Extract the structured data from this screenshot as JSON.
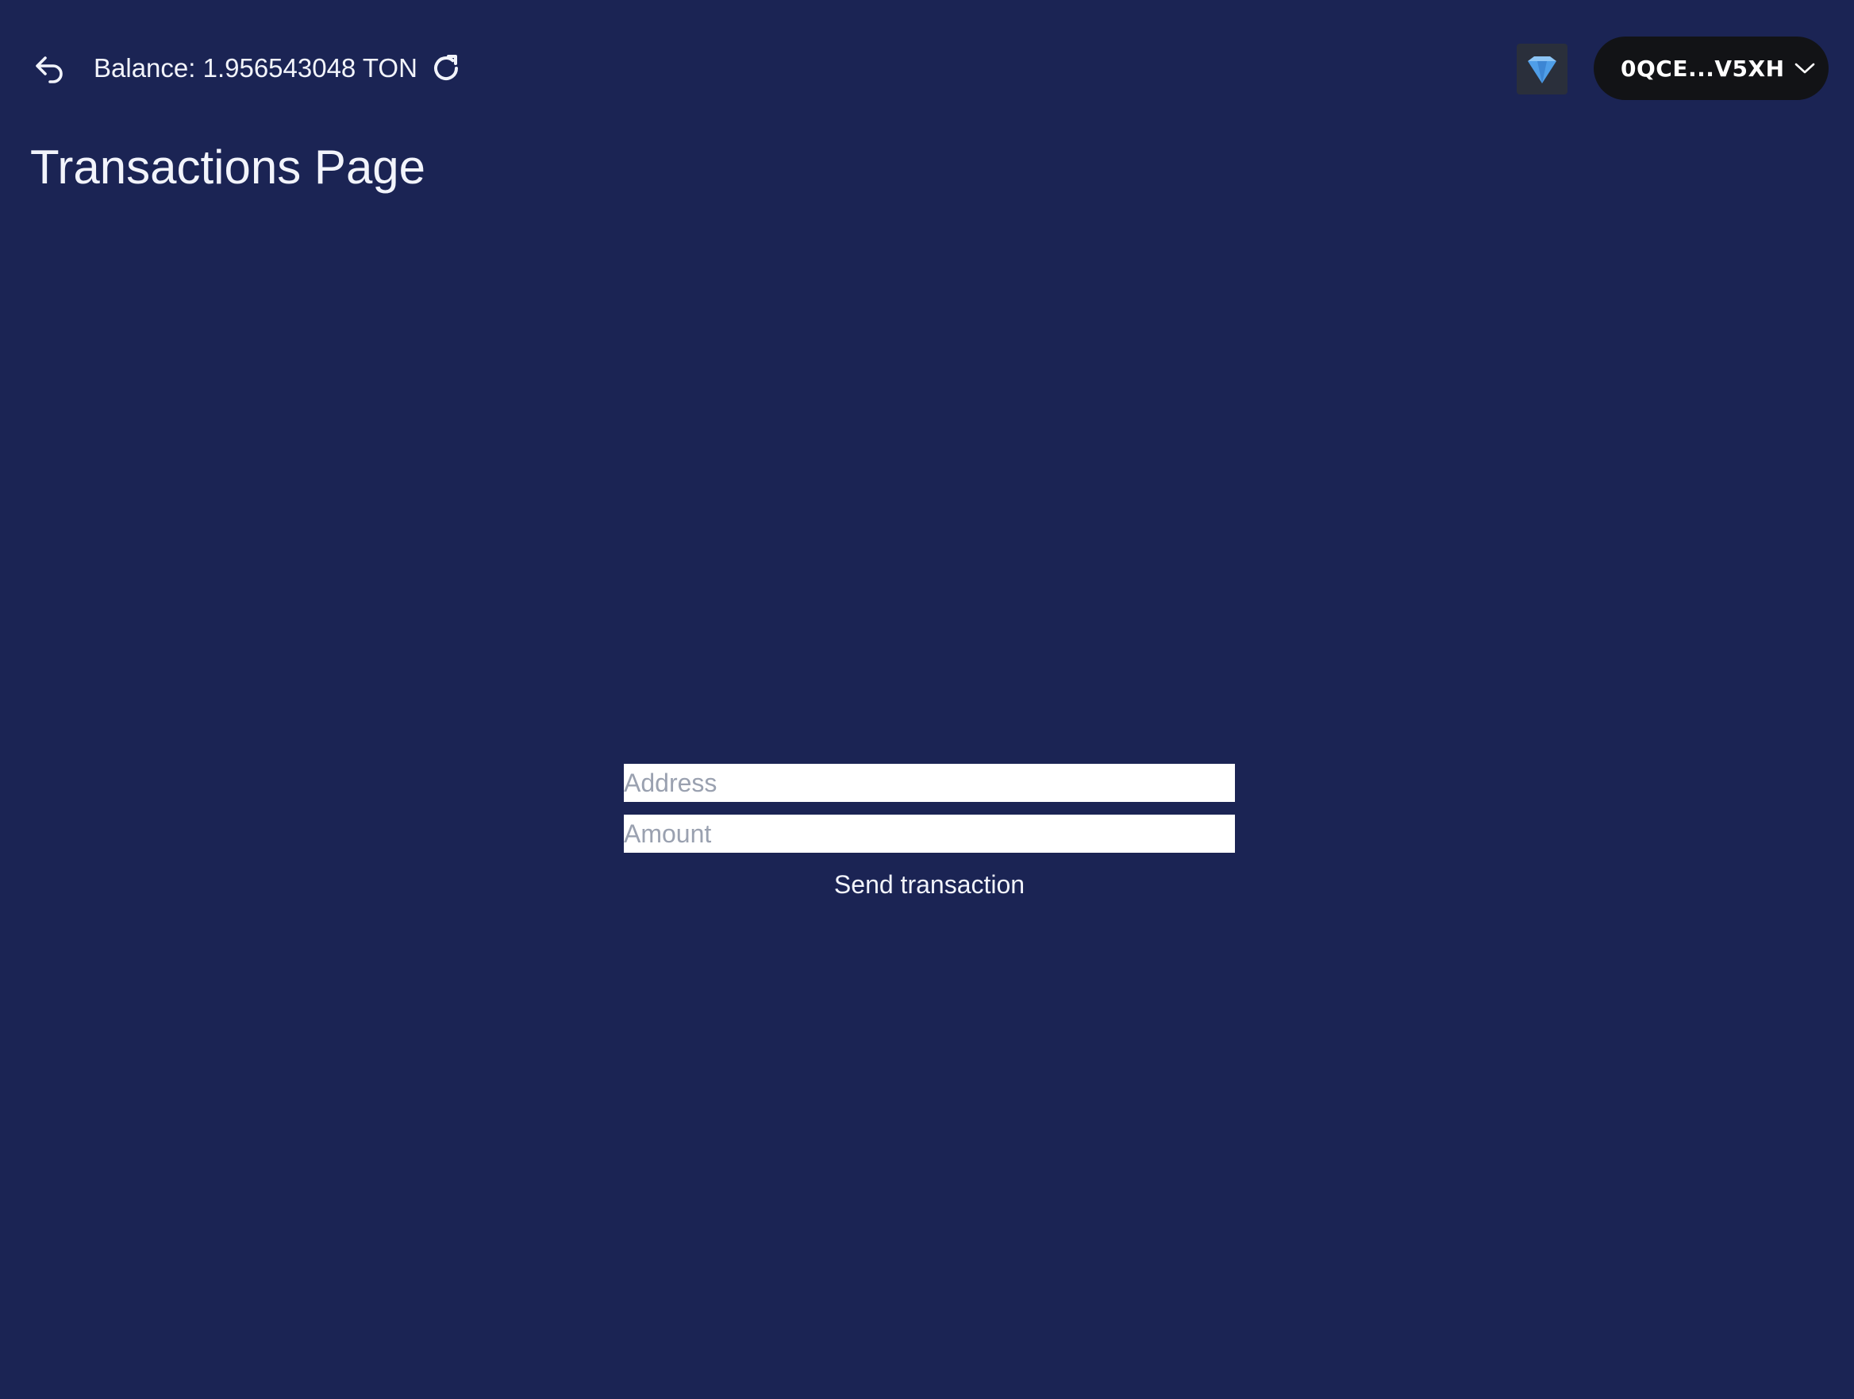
{
  "header": {
    "back_icon": "back-arrow-icon",
    "balance_text": "Balance: 1.956543048 TON",
    "refresh_icon": "refresh-icon",
    "wallet_icon": "ton-diamond-icon",
    "account_label": "0QCE...V5XH",
    "account_chevron_icon": "chevron-down-icon"
  },
  "page": {
    "title": "Transactions Page"
  },
  "form": {
    "address_placeholder": "Address",
    "address_value": "",
    "amount_placeholder": "Amount",
    "amount_value": "",
    "send_label": "Send transaction"
  },
  "colors": {
    "background": "#1b2454",
    "text": "#f2f4fb",
    "account_button_bg": "#121316",
    "wallet_icon_bg": "#2a2f3b",
    "diamond": "#4f9ee8"
  }
}
